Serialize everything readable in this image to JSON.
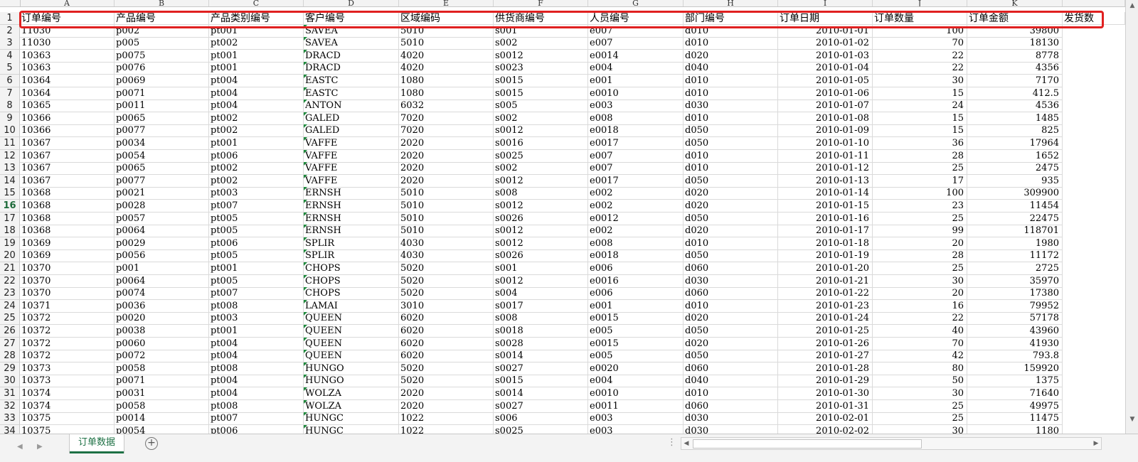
{
  "sheet": {
    "column_letters": [
      "A",
      "B",
      "C",
      "D",
      "E",
      "F",
      "G",
      "H",
      "I",
      "J",
      "K",
      ""
    ],
    "header_row_number": "1",
    "headers": [
      "订单编号",
      "产品编号",
      "产品类别编号",
      "客户编号",
      "区域编码",
      "供货商编号",
      "人员编号",
      "部门编号",
      "订单日期",
      "订单数量",
      "订单金额",
      "发货数"
    ],
    "rows": [
      [
        "2",
        "11030",
        "p002",
        "pt001",
        "SAVEA",
        "5010",
        "s001",
        "e007",
        "d010",
        "2010-01-01",
        "100",
        "39800"
      ],
      [
        "3",
        "11030",
        "p005",
        "pt002",
        "SAVEA",
        "5010",
        "s002",
        "e007",
        "d010",
        "2010-01-02",
        "70",
        "18130"
      ],
      [
        "4",
        "10363",
        "p0075",
        "pt001",
        "DRACD",
        "4020",
        "s0012",
        "e0014",
        "d020",
        "2010-01-03",
        "22",
        "8778"
      ],
      [
        "5",
        "10363",
        "p0076",
        "pt001",
        "DRACD",
        "4020",
        "s0023",
        "e004",
        "d040",
        "2010-01-04",
        "22",
        "4356"
      ],
      [
        "6",
        "10364",
        "p0069",
        "pt004",
        "EASTC",
        "1080",
        "s0015",
        "e001",
        "d010",
        "2010-01-05",
        "30",
        "7170"
      ],
      [
        "7",
        "10364",
        "p0071",
        "pt004",
        "EASTC",
        "1080",
        "s0015",
        "e0010",
        "d010",
        "2010-01-06",
        "15",
        "412.5"
      ],
      [
        "8",
        "10365",
        "p0011",
        "pt004",
        "ANTON",
        "6032",
        "s005",
        "e003",
        "d030",
        "2010-01-07",
        "24",
        "4536"
      ],
      [
        "9",
        "10366",
        "p0065",
        "pt002",
        "GALED",
        "7020",
        "s002",
        "e008",
        "d010",
        "2010-01-08",
        "15",
        "1485"
      ],
      [
        "10",
        "10366",
        "p0077",
        "pt002",
        "GALED",
        "7020",
        "s0012",
        "e0018",
        "d050",
        "2010-01-09",
        "15",
        "825"
      ],
      [
        "11",
        "10367",
        "p0034",
        "pt001",
        "VAFFE",
        "2020",
        "s0016",
        "e0017",
        "d050",
        "2010-01-10",
        "36",
        "17964"
      ],
      [
        "12",
        "10367",
        "p0054",
        "pt006",
        "VAFFE",
        "2020",
        "s0025",
        "e007",
        "d010",
        "2010-01-11",
        "28",
        "1652"
      ],
      [
        "13",
        "10367",
        "p0065",
        "pt002",
        "VAFFE",
        "2020",
        "s002",
        "e007",
        "d010",
        "2010-01-12",
        "25",
        "2475"
      ],
      [
        "14",
        "10367",
        "p0077",
        "pt002",
        "VAFFE",
        "2020",
        "s0012",
        "e0017",
        "d050",
        "2010-01-13",
        "17",
        "935"
      ],
      [
        "15",
        "10368",
        "p0021",
        "pt003",
        "ERNSH",
        "5010",
        "s008",
        "e002",
        "d020",
        "2010-01-14",
        "100",
        "309900"
      ],
      [
        "16",
        "10368",
        "p0028",
        "pt007",
        "ERNSH",
        "5010",
        "s0012",
        "e002",
        "d020",
        "2010-01-15",
        "23",
        "11454"
      ],
      [
        "17",
        "10368",
        "p0057",
        "pt005",
        "ERNSH",
        "5010",
        "s0026",
        "e0012",
        "d050",
        "2010-01-16",
        "25",
        "22475"
      ],
      [
        "18",
        "10368",
        "p0064",
        "pt005",
        "ERNSH",
        "5010",
        "s0012",
        "e002",
        "d020",
        "2010-01-17",
        "99",
        "118701"
      ],
      [
        "19",
        "10369",
        "p0029",
        "pt006",
        "SPLIR",
        "4030",
        "s0012",
        "e008",
        "d010",
        "2010-01-18",
        "20",
        "1980"
      ],
      [
        "20",
        "10369",
        "p0056",
        "pt005",
        "SPLIR",
        "4030",
        "s0026",
        "e0018",
        "d050",
        "2010-01-19",
        "28",
        "11172"
      ],
      [
        "21",
        "10370",
        "p001",
        "pt001",
        "CHOPS",
        "5020",
        "s001",
        "e006",
        "d060",
        "2010-01-20",
        "25",
        "2725"
      ],
      [
        "22",
        "10370",
        "p0064",
        "pt005",
        "CHOPS",
        "5020",
        "s0012",
        "e0016",
        "d030",
        "2010-01-21",
        "30",
        "35970"
      ],
      [
        "23",
        "10370",
        "p0074",
        "pt007",
        "CHOPS",
        "5020",
        "s004",
        "e006",
        "d060",
        "2010-01-22",
        "20",
        "17380"
      ],
      [
        "24",
        "10371",
        "p0036",
        "pt008",
        "LAMAI",
        "3010",
        "s0017",
        "e001",
        "d010",
        "2010-01-23",
        "16",
        "79952"
      ],
      [
        "25",
        "10372",
        "p0020",
        "pt003",
        "QUEEN",
        "6020",
        "s008",
        "e0015",
        "d020",
        "2010-01-24",
        "22",
        "57178"
      ],
      [
        "26",
        "10372",
        "p0038",
        "pt001",
        "QUEEN",
        "6020",
        "s0018",
        "e005",
        "d050",
        "2010-01-25",
        "40",
        "43960"
      ],
      [
        "27",
        "10372",
        "p0060",
        "pt004",
        "QUEEN",
        "6020",
        "s0028",
        "e0015",
        "d020",
        "2010-01-26",
        "70",
        "41930"
      ],
      [
        "28",
        "10372",
        "p0072",
        "pt004",
        "QUEEN",
        "6020",
        "s0014",
        "e005",
        "d050",
        "2010-01-27",
        "42",
        "793.8"
      ],
      [
        "29",
        "10373",
        "p0058",
        "pt008",
        "HUNGO",
        "5020",
        "s0027",
        "e0020",
        "d060",
        "2010-01-28",
        "80",
        "159920"
      ],
      [
        "30",
        "10373",
        "p0071",
        "pt004",
        "HUNGO",
        "5020",
        "s0015",
        "e004",
        "d040",
        "2010-01-29",
        "50",
        "1375"
      ],
      [
        "31",
        "10374",
        "p0031",
        "pt004",
        "WOLZA",
        "2020",
        "s0014",
        "e0010",
        "d010",
        "2010-01-30",
        "30",
        "71640"
      ],
      [
        "32",
        "10374",
        "p0058",
        "pt008",
        "WOLZA",
        "2020",
        "s0027",
        "e0011",
        "d060",
        "2010-01-31",
        "25",
        "49975"
      ],
      [
        "33",
        "10375",
        "p0014",
        "pt007",
        "HUNGC",
        "1022",
        "s006",
        "e003",
        "d030",
        "2010-02-01",
        "25",
        "11475"
      ],
      [
        "34",
        "10375",
        "p0054",
        "pt006",
        "HUNGC",
        "1022",
        "s0025",
        "e003",
        "d030",
        "2010-02-02",
        "30",
        "1180"
      ]
    ]
  },
  "sheet_tab": {
    "label": "订单数据"
  },
  "active_row": "16",
  "colors": {
    "highlight": "#e02020",
    "accent": "#1e7145",
    "text_number_flag": "#1f8b3d"
  },
  "icons": {
    "add_sheet": "plus-circle-icon",
    "more": "ellipsis-icon"
  }
}
